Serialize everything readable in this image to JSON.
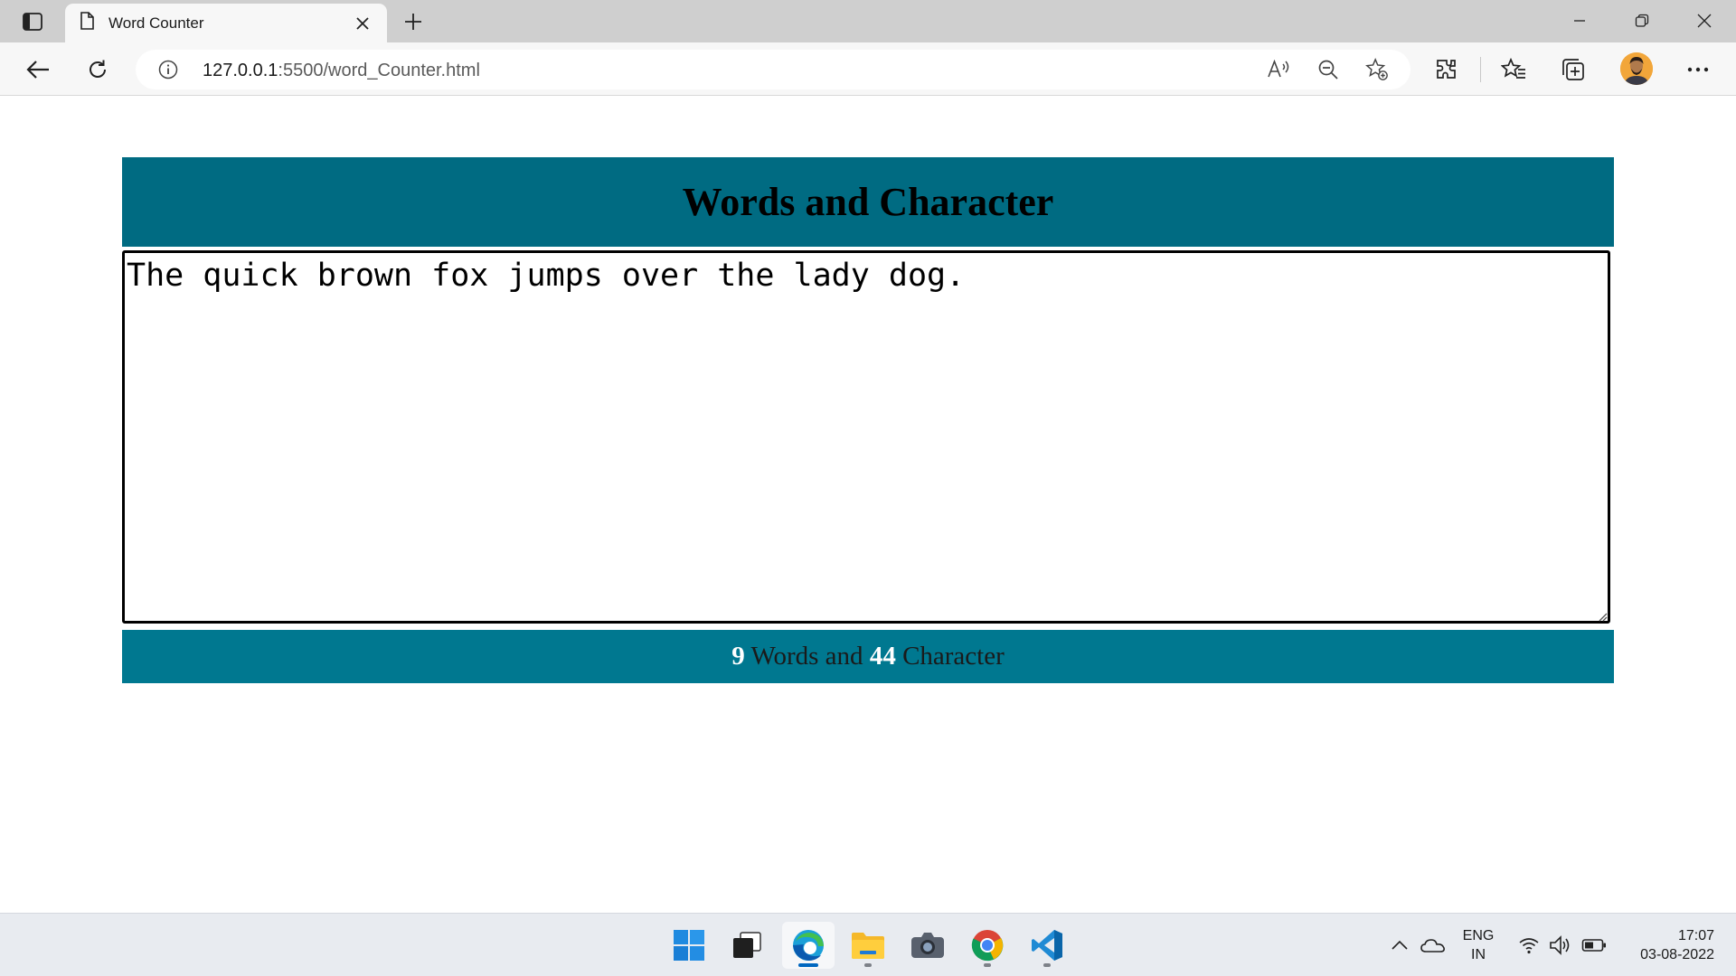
{
  "browser": {
    "tab_title": "Word Counter",
    "url_host": "127.0.0.1",
    "url_rest": ":5500/word_Counter.html"
  },
  "page": {
    "heading": "Words and Character",
    "textarea_value": "The quick brown fox jumps over the lady dog.",
    "word_count": "9",
    "words_label": " Words and ",
    "char_count": "44",
    "chars_label": " Character"
  },
  "taskbar": {
    "language_line1": "ENG",
    "language_line2": "IN",
    "time": "17:07",
    "date": "03-08-2022"
  },
  "colors": {
    "header_bg": "#006b82",
    "footer_bg": "#007890"
  }
}
